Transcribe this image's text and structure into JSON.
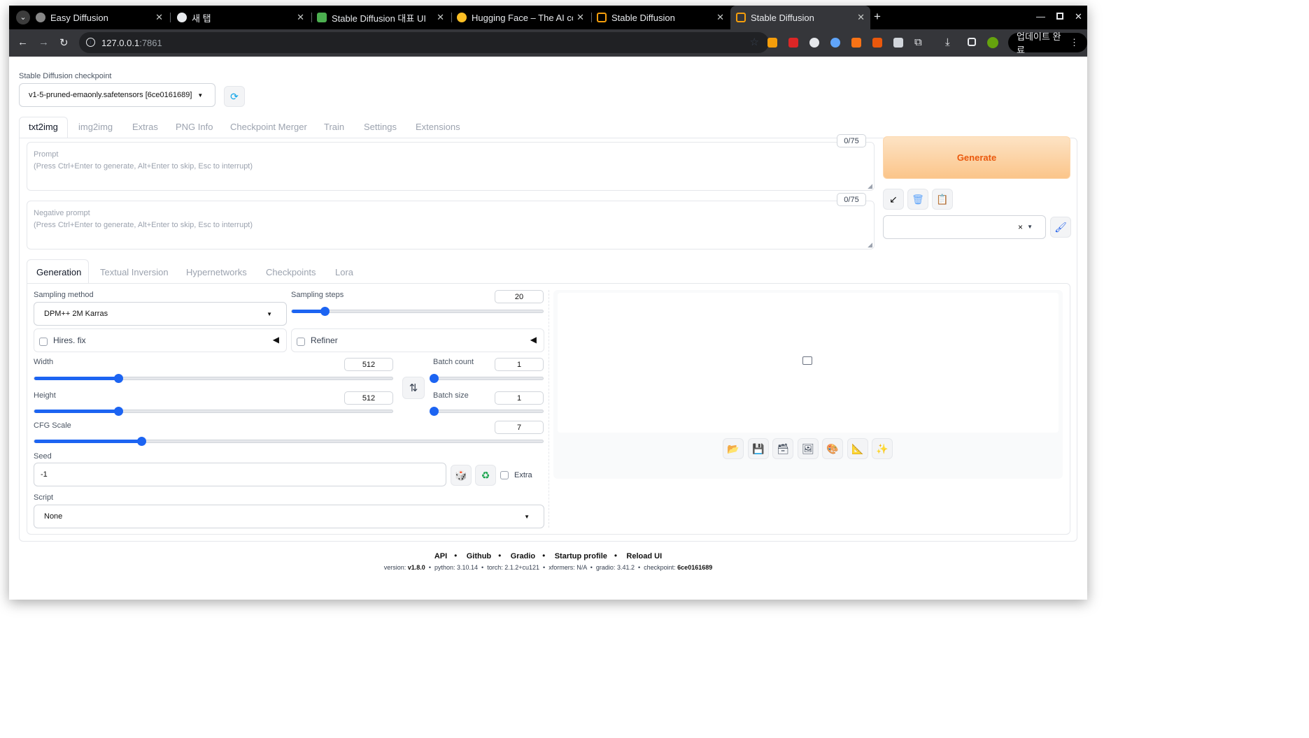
{
  "browser": {
    "tabs": [
      {
        "title": "Easy Diffusion",
        "active": false
      },
      {
        "title": "새 탭",
        "active": false
      },
      {
        "title": "Stable Diffusion 대표 UI",
        "active": false
      },
      {
        "title": "Hugging Face – The AI co",
        "active": false
      },
      {
        "title": "Stable Diffusion",
        "active": false
      },
      {
        "title": "Stable Diffusion",
        "active": true
      }
    ],
    "new_tab": "+",
    "url_host": "127.0.0.1",
    "url_port": ":7861",
    "update_label": "업데이트 완료",
    "colors": {
      "tabbar": "#000000",
      "toolbar": "#35363a"
    }
  },
  "checkpoint": {
    "label": "Stable Diffusion checkpoint",
    "value": "v1-5-pruned-emaonly.safetensors [6ce0161689]"
  },
  "main_tabs": [
    "txt2img",
    "img2img",
    "Extras",
    "PNG Info",
    "Checkpoint Merger",
    "Train",
    "Settings",
    "Extensions"
  ],
  "prompt": {
    "label": "Prompt",
    "hint": "(Press Ctrl+Enter to generate, Alt+Enter to skip, Esc to interrupt)",
    "counter": "0/75"
  },
  "negative_prompt": {
    "label": "Negative prompt",
    "hint": "(Press Ctrl+Enter to generate, Alt+Enter to skip, Esc to interrupt)",
    "counter": "0/75"
  },
  "generate_label": "Generate",
  "action_icons": [
    "arrow-icon",
    "trash-icon",
    "clipboard-icon",
    "brush-icon"
  ],
  "styles_clear": "×",
  "sub_tabs": [
    "Generation",
    "Textual Inversion",
    "Hypernetworks",
    "Checkpoints",
    "Lora"
  ],
  "sampling_method": {
    "label": "Sampling method",
    "value": "DPM++ 2M Karras"
  },
  "sampling_steps": {
    "label": "Sampling steps",
    "value": "20",
    "fraction": 0.13
  },
  "hires_fix": {
    "label": "Hires. fix",
    "checked": false
  },
  "refiner": {
    "label": "Refiner",
    "checked": false
  },
  "width": {
    "label": "Width",
    "value": "512",
    "fraction": 0.235
  },
  "height": {
    "label": "Height",
    "value": "512",
    "fraction": 0.235
  },
  "batch_count": {
    "label": "Batch count",
    "value": "1",
    "fraction": 0.0
  },
  "batch_size": {
    "label": "Batch size",
    "value": "1",
    "fraction": 0.0
  },
  "cfg_scale": {
    "label": "CFG Scale",
    "value": "7",
    "fraction": 0.21
  },
  "seed": {
    "label": "Seed",
    "value": "-1",
    "extra_label": "Extra"
  },
  "script": {
    "label": "Script",
    "value": "None"
  },
  "output_icons": [
    "folder-icon",
    "save-icon",
    "zip-icon",
    "image-icon",
    "palette-icon",
    "ruler-icon",
    "sparkles-icon"
  ],
  "footer": {
    "links": [
      "API",
      "Github",
      "Gradio",
      "Startup profile",
      "Reload UI"
    ],
    "version": [
      {
        "k": "version:",
        "v": "v1.8.0"
      },
      {
        "k": "python:",
        "v": "3.10.14"
      },
      {
        "k": "torch:",
        "v": "2.1.2+cu121"
      },
      {
        "k": "xformers:",
        "v": "N/A"
      },
      {
        "k": "gradio:",
        "v": "3.41.2"
      },
      {
        "k": "checkpoint:",
        "v": "6ce0161689"
      }
    ]
  }
}
